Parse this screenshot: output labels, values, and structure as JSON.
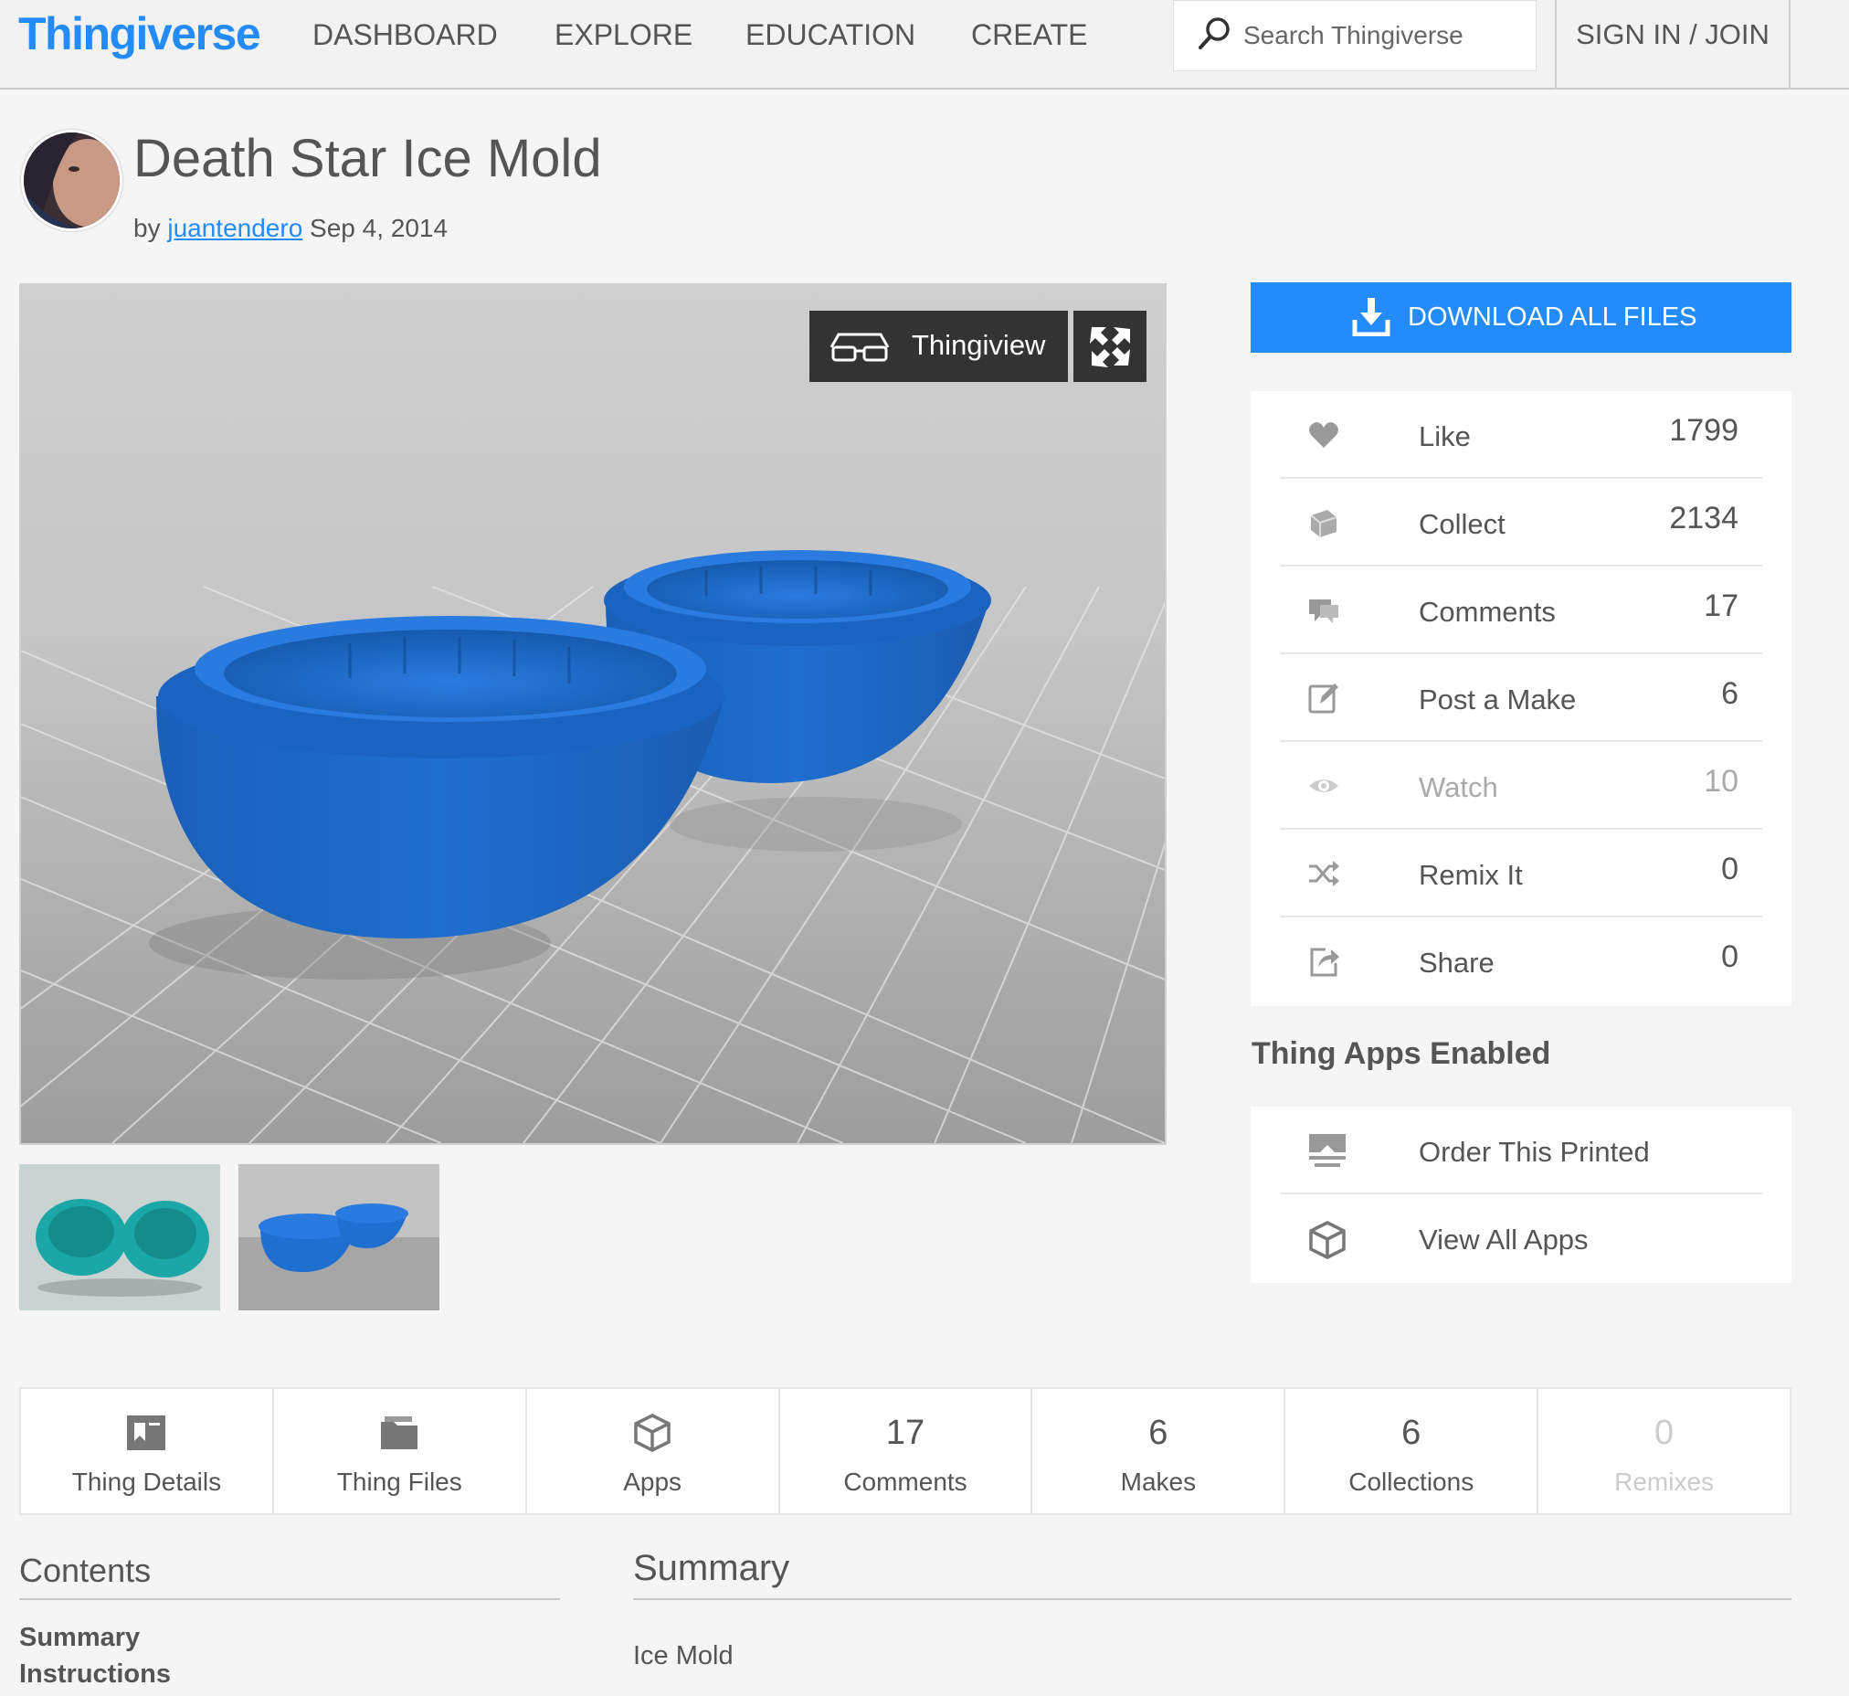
{
  "header": {
    "logo": "Thingiverse",
    "nav": [
      "DASHBOARD",
      "EXPLORE",
      "EDUCATION",
      "CREATE"
    ],
    "search_placeholder": "Search Thingiverse",
    "signin": "SIGN IN / JOIN"
  },
  "thing": {
    "title": "Death Star Ice Mold",
    "by": "by",
    "author": "juantendero",
    "date": "Sep 4, 2014"
  },
  "viewer": {
    "thingiview_label": "Thingiview"
  },
  "sidebar": {
    "download_label": "DOWNLOAD ALL FILES",
    "stats": [
      {
        "icon": "heart-icon",
        "label": "Like",
        "count": "1799"
      },
      {
        "icon": "collect-icon",
        "label": "Collect",
        "count": "2134"
      },
      {
        "icon": "comments-icon",
        "label": "Comments",
        "count": "17"
      },
      {
        "icon": "edit-icon",
        "label": "Post a Make",
        "count": "6"
      },
      {
        "icon": "eye-icon",
        "label": "Watch",
        "count": "10"
      },
      {
        "icon": "shuffle-icon",
        "label": "Remix It",
        "count": "0"
      },
      {
        "icon": "share-icon",
        "label": "Share",
        "count": "0"
      }
    ],
    "apps_title": "Thing Apps Enabled",
    "apps": [
      {
        "icon": "printer-icon",
        "label": "Order This Printed"
      },
      {
        "icon": "cube-icon",
        "label": "View All Apps"
      }
    ]
  },
  "tabs": [
    {
      "icon": "details-icon",
      "value": "",
      "label": "Thing Details"
    },
    {
      "icon": "folder-icon",
      "value": "",
      "label": "Thing Files"
    },
    {
      "icon": "cube-icon",
      "value": "",
      "label": "Apps"
    },
    {
      "icon": "",
      "value": "17",
      "label": "Comments"
    },
    {
      "icon": "",
      "value": "6",
      "label": "Makes"
    },
    {
      "icon": "",
      "value": "6",
      "label": "Collections"
    },
    {
      "icon": "",
      "value": "0",
      "label": "Remixes"
    }
  ],
  "contents": {
    "title": "Contents",
    "links": [
      "Summary",
      "Instructions"
    ]
  },
  "summary": {
    "title": "Summary",
    "text": "Ice Mold"
  },
  "colors": {
    "brand": "#248bfb",
    "model_blue": "#1f6fd0",
    "thumb_teal": "#1ba7a6"
  }
}
